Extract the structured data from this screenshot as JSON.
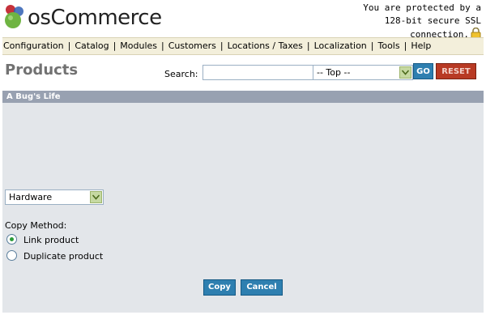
{
  "header": {
    "logo_text": "osCommerce",
    "ssl_lines": [
      "You are protected by a",
      "128-bit secure SSL",
      "connection."
    ]
  },
  "menu": {
    "items": [
      "Configuration",
      "Catalog",
      "Modules",
      "Customers",
      "Locations / Taxes",
      "Localization",
      "Tools",
      "Help"
    ]
  },
  "page": {
    "title": "Products",
    "search_label": "Search:",
    "search_value": "",
    "category_selected": "-- Top --",
    "go_label": "GO",
    "reset_label": "RESET"
  },
  "panel": {
    "heading": "A Bug's Life",
    "target_category": "Hardware",
    "copy_method_label": "Copy Method:",
    "options": [
      {
        "label": "Link product",
        "checked": true
      },
      {
        "label": "Duplicate product",
        "checked": false
      }
    ],
    "copy_label": "Copy",
    "cancel_label": "Cancel"
  },
  "colors": {
    "menu_bg": "#f3efdb",
    "panel_header": "#98a1b1",
    "panel_bg": "#e3e6ea",
    "button_blue": "#2e7fb0",
    "button_reset": "#b83a24",
    "title": "#727272"
  },
  "icons": [
    "oscommerce-logo-icon",
    "lock-icon",
    "chevron-down-icon",
    "radio-icon"
  ]
}
